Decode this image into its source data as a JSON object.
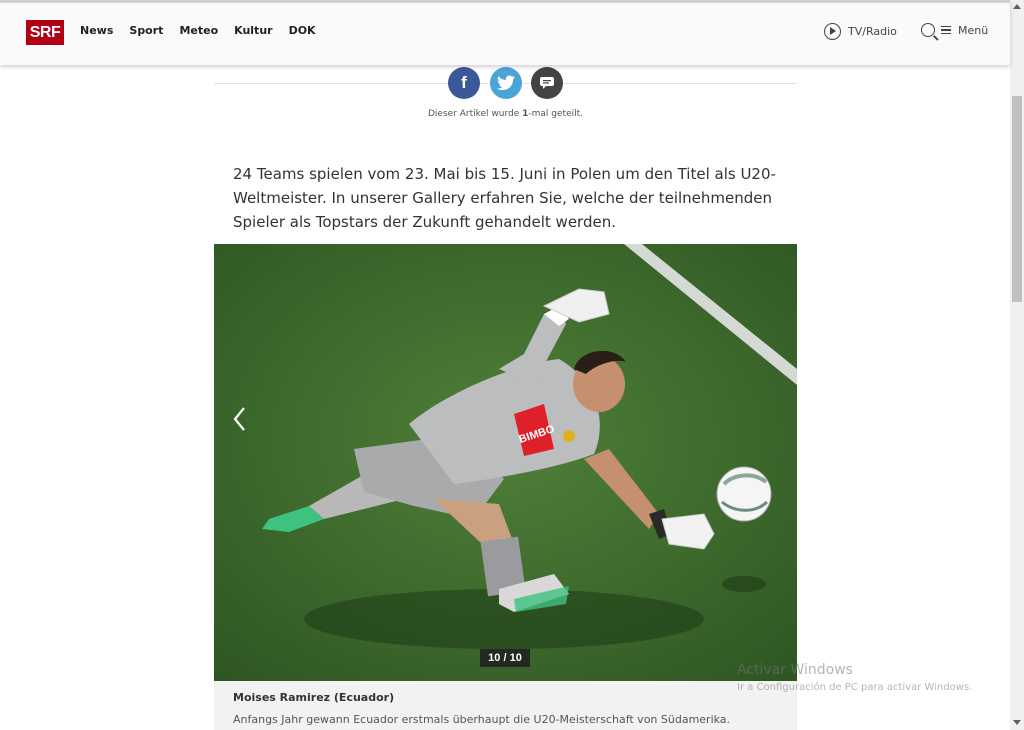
{
  "header": {
    "logo_text": "SRF",
    "nav": [
      "News",
      "Sport",
      "Meteo",
      "Kultur",
      "DOK"
    ],
    "tvradio_label": "TV/Radio",
    "menu_label": "Menü"
  },
  "share": {
    "icons": [
      "facebook-icon",
      "twitter-icon",
      "comment-icon"
    ],
    "count_prefix": "Dieser Artikel wurde ",
    "count_value": "1",
    "count_suffix": "-mal geteilt."
  },
  "article": {
    "lead": "24 Teams spielen vom 23. Mai bis 15. Juni in Polen um den Titel als U20-Weltmeister. In unserer Gallery erfahren Sie, welche der teilnehmenden Spieler als Topstars der Zukunft gehandelt werden."
  },
  "gallery": {
    "counter": "10 / 10",
    "caption_title": "Moises Ramirez (Ecuador)",
    "caption_text": "Anfangs Jahr gewann Ecuador erstmals überhaupt die U20-Meisterschaft von Südamerika.",
    "jersey_text": "BIMBO"
  },
  "watermark": {
    "title": "Activar Windows",
    "subtitle": "Ir a Configuración de PC para activar Windows."
  },
  "colors": {
    "brand": "#af0016",
    "facebook": "#3b5998",
    "twitter": "#4aa5d6",
    "comment": "#444444",
    "pitch": "#3f6d2f"
  }
}
